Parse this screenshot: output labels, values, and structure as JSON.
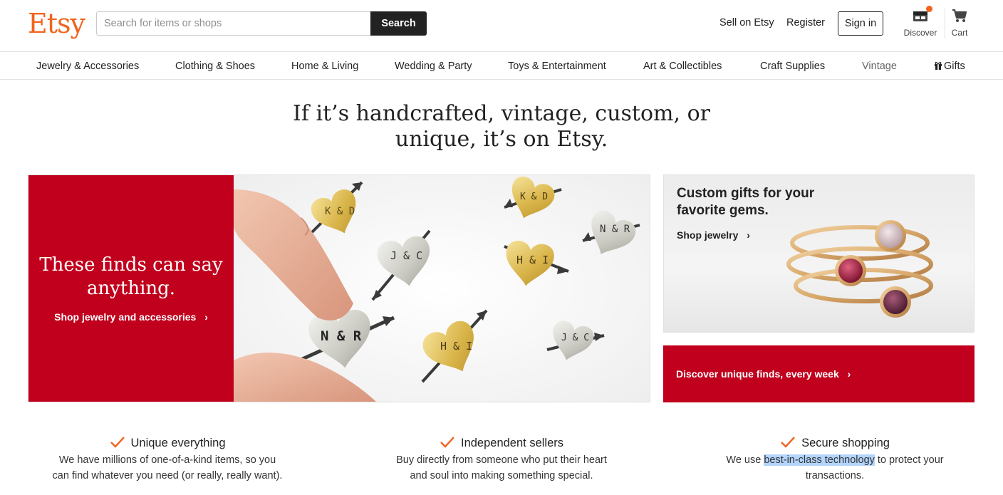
{
  "brand": {
    "logo_text": "Etsy",
    "accent": "#f1641e",
    "red": "#c0001d"
  },
  "header": {
    "search_placeholder": "Search for items or shops",
    "search_button": "Search",
    "sell_link": "Sell on Etsy",
    "register_link": "Register",
    "signin_button": "Sign in",
    "discover_label": "Discover",
    "cart_label": "Cart"
  },
  "categories": [
    "Jewelry & Accessories",
    "Clothing & Shoes",
    "Home & Living",
    "Wedding & Party",
    "Toys & Entertainment",
    "Art & Collectibles",
    "Craft Supplies",
    "Vintage",
    "Gifts"
  ],
  "hero": {
    "headline_line1": "If it’s handcrafted, vintage, custom, or",
    "headline_line2": "unique, it’s on Etsy."
  },
  "feature": {
    "title_line1": "These finds can say",
    "title_line2": "anything.",
    "link": "Shop jewelry and accessories",
    "pin_labels": [
      "K & D",
      "J & C",
      "N & R",
      "H & I",
      "N & R",
      "H & I",
      "K & D",
      "J & C"
    ]
  },
  "gift_tile": {
    "title_line1": "Custom gifts for your",
    "title_line2": "favorite gems.",
    "link": "Shop jewelry"
  },
  "discover_tile": {
    "link": "Discover unique finds, every week"
  },
  "props": [
    {
      "title": "Unique everything",
      "line1": "We have millions of one-of-a-kind items, so you",
      "line2": "can find whatever you need (or really, really want)."
    },
    {
      "title": "Independent sellers",
      "line1": "Buy directly from someone who put their heart",
      "line2": "and soul into making something special."
    },
    {
      "title": "Secure shopping",
      "line1_pre": "We use ",
      "line1_hl": "best-in-class technology",
      "line1_post": " to protect your",
      "line2": "transactions."
    }
  ]
}
